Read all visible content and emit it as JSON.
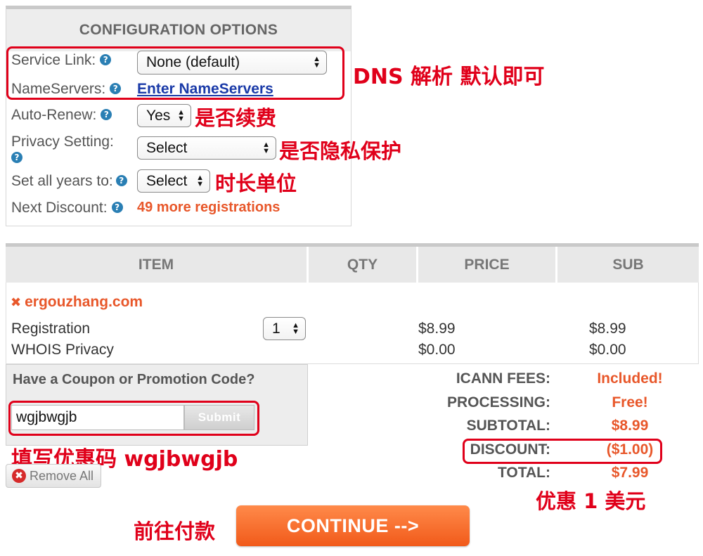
{
  "config": {
    "header": "CONFIGURATION OPTIONS",
    "service_link": {
      "label": "Service Link:",
      "value": "None (default)"
    },
    "nameservers": {
      "label": "NameServers:",
      "link": "Enter NameServers"
    },
    "auto_renew": {
      "label": "Auto-Renew:",
      "value": "Yes"
    },
    "privacy": {
      "label": "Privacy Setting:",
      "value": "Select"
    },
    "years": {
      "label": "Set all years to:",
      "value": "Select"
    },
    "next_discount": {
      "label": "Next Discount:",
      "value": "49 more registrations"
    }
  },
  "annotations": {
    "dns": "DNS 解析 默认即可",
    "auto_renew": "是否续费",
    "privacy": "是否隐私保护",
    "years": "时长单位",
    "coupon": "填写优惠码 wgjbwgjb",
    "discount": "优惠 1 美元",
    "continue": "前往付款"
  },
  "cart": {
    "columns": [
      "ITEM",
      "QTY",
      "PRICE",
      "SUB"
    ],
    "domain": "ergouzhang.com",
    "rows": [
      {
        "item": "Registration",
        "qty": "1",
        "price": "$8.99",
        "sub": "$8.99"
      },
      {
        "item": "WHOIS Privacy",
        "qty": "",
        "price": "$0.00",
        "sub": "$0.00"
      }
    ]
  },
  "coupon": {
    "title": "Have a Coupon or Promotion Code?",
    "value": "wgjbwgjb",
    "submit": "Submit"
  },
  "remove_all": "Remove All",
  "summary": [
    {
      "label": "ICANN FEES:",
      "value": "Included!"
    },
    {
      "label": "PROCESSING:",
      "value": "Free!"
    },
    {
      "label": "SUBTOTAL:",
      "value": "$8.99"
    },
    {
      "label": "DISCOUNT:",
      "value": "($1.00)"
    },
    {
      "label": "TOTAL:",
      "value": "$7.99"
    }
  ],
  "continue": "CONTINUE -->",
  "colors": {
    "accent": "#e8572a",
    "annotation": "#e0001a",
    "link": "#1a3aa8"
  }
}
